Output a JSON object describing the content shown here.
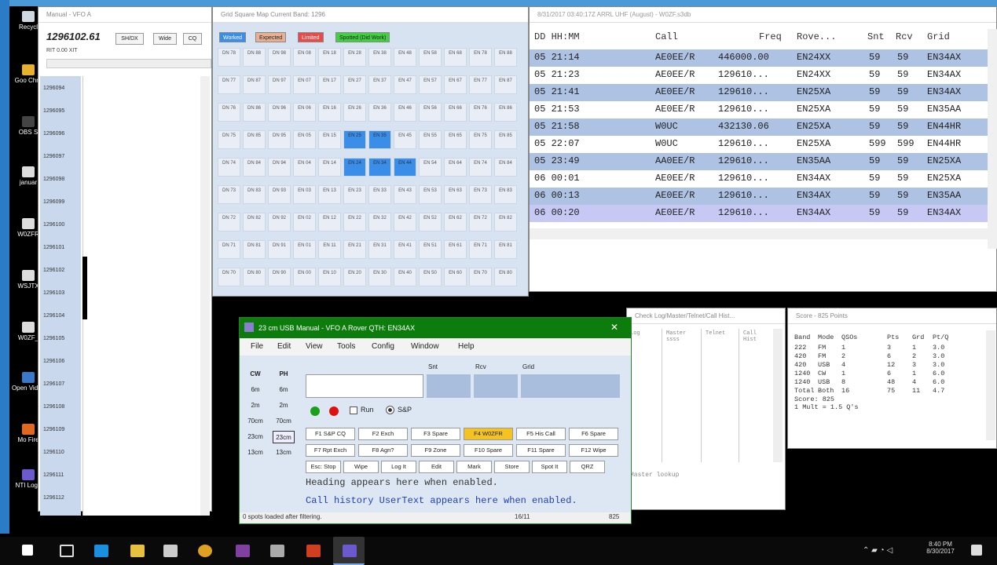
{
  "desktop": {
    "icons": [
      "Recycl",
      "Goo Chro",
      "OBS S",
      "januar",
      "W0ZFR",
      "WSJTX",
      "W0ZF_",
      "Open Video",
      "Mo Fire",
      "NTI Logg"
    ]
  },
  "vfo": {
    "title": "Manual - VFO A",
    "frequency": "1296102.61",
    "btn_srch": "SH/DX",
    "btn_wide": "Wide",
    "btn_cq": "CQ",
    "rit": "RIT",
    "rit_val": "0.00",
    "xit": "XIT",
    "bandmap": [
      "1296094",
      "1296095",
      "1296096",
      "1296097",
      "1296098",
      "1296099",
      "1296100",
      "1296101",
      "1296102",
      "1296103",
      "1296104",
      "1296105",
      "1296106",
      "1296107",
      "1296108",
      "1296109",
      "1296110",
      "1296111",
      "1296112"
    ]
  },
  "grid": {
    "title": "Grid Square Map   Current Band: 1296",
    "legend": {
      "worked": "Worked",
      "expected": "Expected",
      "limited": "Limited",
      "spotted": "Spotted (Did Work)"
    },
    "rows": [
      [
        "DN 78",
        "DN 88",
        "DN 98",
        "EN 08",
        "EN 18",
        "EN 28",
        "EN 38",
        "EN 48",
        "EN 58",
        "EN 68",
        "EN 78",
        "EN 88"
      ],
      [
        "DN 77",
        "DN 87",
        "DN 97",
        "EN 07",
        "EN 17",
        "EN 27",
        "EN 37",
        "EN 47",
        "EN 57",
        "EN 67",
        "EN 77",
        "EN 87"
      ],
      [
        "DN 76",
        "DN 86",
        "DN 96",
        "EN 06",
        "EN 16",
        "EN 26",
        "EN 36",
        "EN 46",
        "EN 56",
        "EN 66",
        "EN 76",
        "EN 86"
      ],
      [
        "DN 75",
        "DN 85",
        "DN 95",
        "EN 05",
        "EN 15",
        "EN 25",
        "EN 35",
        "EN 45",
        "EN 55",
        "EN 65",
        "EN 75",
        "EN 85"
      ],
      [
        "DN 74",
        "DN 84",
        "DN 94",
        "EN 04",
        "EN 14",
        "EN 24",
        "EN 34",
        "EN 44",
        "EN 54",
        "EN 64",
        "EN 74",
        "EN 84"
      ],
      [
        "DN 73",
        "DN 83",
        "DN 93",
        "EN 03",
        "EN 13",
        "EN 23",
        "EN 33",
        "EN 43",
        "EN 53",
        "EN 63",
        "EN 73",
        "EN 83"
      ],
      [
        "DN 72",
        "DN 82",
        "DN 92",
        "EN 02",
        "EN 12",
        "EN 22",
        "EN 32",
        "EN 42",
        "EN 52",
        "EN 62",
        "EN 72",
        "EN 82"
      ],
      [
        "DN 71",
        "DN 81",
        "DN 91",
        "EN 01",
        "EN 11",
        "EN 21",
        "EN 31",
        "EN 41",
        "EN 51",
        "EN 61",
        "EN 71",
        "EN 81"
      ],
      [
        "DN 70",
        "DN 80",
        "DN 90",
        "EN 00",
        "EN 10",
        "EN 20",
        "EN 30",
        "EN 40",
        "EN 50",
        "EN 60",
        "EN 70",
        "EN 80"
      ]
    ],
    "worked": [
      "EN 25",
      "EN 35",
      "EN 24",
      "EN 34",
      "EN 44"
    ],
    "colors": {
      "worked": "#3b8ee8",
      "expected": "#e8b090",
      "limited": "#e84a4a",
      "spotted": "#40d040"
    }
  },
  "log": {
    "title": "8/31/2017 03:40:17Z  ARRL UHF (August) - W0ZF.s3db",
    "headers": [
      "DD HH:MM",
      "Call",
      "Freq",
      "Rove...",
      "Snt",
      "Rcv",
      "Grid"
    ],
    "rows": [
      {
        "time": "05 21:14",
        "call": "AE0EE/R",
        "freq": "446000.00",
        "rove": "EN24XX",
        "snt": "59",
        "rcv": "59",
        "grid": "EN34AX"
      },
      {
        "time": "05 21:23",
        "call": "AE0EE/R",
        "freq": "129610...",
        "rove": "EN24XX",
        "snt": "59",
        "rcv": "59",
        "grid": "EN34AX"
      },
      {
        "time": "05 21:41",
        "call": "AE0EE/R",
        "freq": "129610...",
        "rove": "EN25XA",
        "snt": "59",
        "rcv": "59",
        "grid": "EN34AX"
      },
      {
        "time": "05 21:53",
        "call": "AE0EE/R",
        "freq": "129610...",
        "rove": "EN25XA",
        "snt": "59",
        "rcv": "59",
        "grid": "EN35AA"
      },
      {
        "time": "05 21:58",
        "call": "W0UC",
        "freq": "432130.06",
        "rove": "EN25XA",
        "snt": "59",
        "rcv": "59",
        "grid": "EN44HR"
      },
      {
        "time": "05 22:07",
        "call": "W0UC",
        "freq": "129610...",
        "rove": "EN25XA",
        "snt": "599",
        "rcv": "599",
        "grid": "EN44HR"
      },
      {
        "time": "05 23:49",
        "call": "AA0EE/R",
        "freq": "129610...",
        "rove": "EN35AA",
        "snt": "59",
        "rcv": "59",
        "grid": "EN25XA"
      },
      {
        "time": "06 00:01",
        "call": "AE0EE/R",
        "freq": "129610...",
        "rove": "EN34AX",
        "snt": "59",
        "rcv": "59",
        "grid": "EN25XA"
      },
      {
        "time": "06 00:13",
        "call": "AE0EE/R",
        "freq": "129610...",
        "rove": "EN34AX",
        "snt": "59",
        "rcv": "59",
        "grid": "EN35AA"
      },
      {
        "time": "06 00:20",
        "call": "AE0EE/R",
        "freq": "129610...",
        "rove": "EN34AX",
        "snt": "59",
        "rcv": "59",
        "grid": "EN34AX"
      }
    ]
  },
  "check": {
    "title": "Check Log/Master/Telnet/Call Hist...",
    "cols": [
      "Log",
      "Master ssss",
      "Telnet ",
      "Call Hist"
    ],
    "footer": "Master lookup"
  },
  "score": {
    "title": "Score - 825 Points",
    "headers": [
      "Band",
      "Mode",
      "QSOs",
      "Pts",
      "Grd",
      "Pt/Q"
    ],
    "rows": [
      [
        "222",
        "FM",
        "1",
        "3",
        "1",
        "3.0"
      ],
      [
        "420",
        "FM",
        "2",
        "6",
        "2",
        "3.0"
      ],
      [
        "420",
        "USB",
        "4",
        "12",
        "3",
        "3.0"
      ],
      [
        "1240",
        "CW",
        "1",
        "6",
        "1",
        "6.0"
      ],
      [
        "1240",
        "USB",
        "8",
        "48",
        "4",
        "6.0"
      ],
      [
        "Total",
        "Both",
        "16",
        "75",
        "11",
        "4.7"
      ]
    ],
    "score_line": "Score: 825",
    "mult_line": "1 Mult = 1.5 Q's"
  },
  "entry": {
    "title": "23 cm USB Manual - VFO A   Rover QTH: EN34AX",
    "menu": [
      "File",
      "Edit",
      "View",
      "Tools",
      "Config",
      "Window",
      "Help"
    ],
    "cw_label": "CW",
    "ph_label": "PH",
    "bands": [
      [
        "6m",
        "6m"
      ],
      [
        "2m",
        "2m"
      ],
      [
        "70cm",
        "70cm"
      ],
      [
        "23cm",
        "23cm"
      ],
      [
        "13cm",
        "13cm"
      ]
    ],
    "field_snt": "Snt",
    "field_rcv": "Rcv",
    "field_grid": "Grid",
    "run_label": "Run",
    "sp_label": "S&P",
    "fkeys": [
      [
        "F1 S&P CQ",
        "F2 Exch",
        "F3 Spare",
        "F4 W0ZFR",
        "F5 His Call",
        "F6 Spare"
      ],
      [
        "F7 Rpt Exch",
        "F8 Agn?",
        "F9 Zone",
        "F10 Spare",
        "F11 Spare",
        "F12 Wipe"
      ],
      [
        "Esc: Stop",
        "Wipe",
        "Log It",
        "Edit",
        "Mark",
        "Store",
        "Spot It",
        "QRZ"
      ]
    ],
    "heading": "Heading appears here when enabled.",
    "callhist": "Call history UserText appears here when enabled.",
    "status_left": "0 spots loaded after filtering.",
    "status_mid": "16/11",
    "status_right": "825"
  },
  "taskbar": {
    "time": "8:40 PM",
    "date": "8/30/2017"
  }
}
